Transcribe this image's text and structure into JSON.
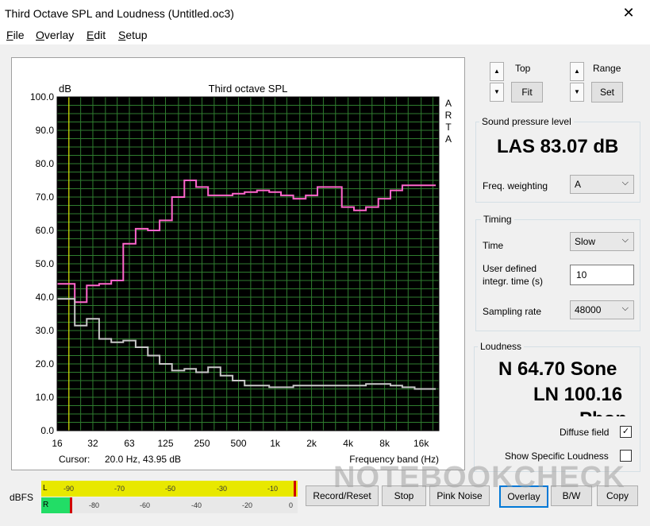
{
  "window": {
    "title": "Third Octave SPL and Loudness (Untitled.oc3)",
    "close_glyph": "✕"
  },
  "menu": [
    {
      "key": "F",
      "rest": "ile"
    },
    {
      "key": "O",
      "rest": "verlay"
    },
    {
      "key": "E",
      "rest": "dit"
    },
    {
      "key": "S",
      "rest": "etup"
    }
  ],
  "controls": {
    "top_label": "Top",
    "fit_label": "Fit",
    "range_label": "Range",
    "set_label": "Set",
    "spl_group": "Sound pressure level",
    "las_value": "LAS 83.07 dB",
    "freq_weighting_label": "Freq. weighting",
    "freq_weighting_value": "A",
    "timing_group": "Timing",
    "time_label": "Time",
    "time_value": "Slow",
    "user_integr_label_1": "User defined",
    "user_integr_label_2": "integr. time (s)",
    "user_integr_value": "10",
    "sampling_rate_label": "Sampling rate",
    "sampling_rate_value": "48000",
    "loudness_group": "Loudness",
    "loudness_n": "N 64.70 Sone",
    "loudness_ln": "LN 100.16",
    "loudness_unit": "Phon",
    "diffuse_field_label": "Diffuse field",
    "diffuse_field_checked": true,
    "show_specific_label": "Show Specific Loudness",
    "show_specific_checked": false
  },
  "bottom": {
    "dbfs_label": "dBFS",
    "meter_top_channel": "L",
    "meter_bot_channel": "R",
    "meter_top_ticks": [
      "-90",
      "-70",
      "-50",
      "-30",
      "-10"
    ],
    "meter_bot_ticks": [
      "-80",
      "-60",
      "-40",
      "-20",
      "0"
    ],
    "buttons": [
      "Record/Reset",
      "Stop",
      "Pink Noise",
      "Overlay",
      "B/W",
      "Copy"
    ]
  },
  "watermark": "NOTEBOOKCHECK",
  "chart_data": {
    "type": "line",
    "title": "Third octave SPL",
    "ylabel": "dB",
    "xlabel": "Frequency band (Hz)",
    "side_label": "ARTA",
    "ylim": [
      0,
      100
    ],
    "y_ticks": [
      "100.0",
      "90.0",
      "80.0",
      "70.0",
      "60.0",
      "50.0",
      "40.0",
      "30.0",
      "20.0",
      "10.0",
      "0.0"
    ],
    "x_ticks": [
      "16",
      "32",
      "63",
      "125",
      "250",
      "500",
      "1k",
      "2k",
      "4k",
      "8k",
      "16k"
    ],
    "cursor_label": "Cursor:",
    "cursor_value": "20.0 Hz, 43.95 dB",
    "cursor_hz": 20,
    "bands": [
      "16",
      "20",
      "25",
      "31.5",
      "40",
      "50",
      "63",
      "80",
      "100",
      "125",
      "160",
      "200",
      "250",
      "315",
      "400",
      "500",
      "630",
      "800",
      "1k",
      "1.25k",
      "1.6k",
      "2k",
      "2.5k",
      "3.15k",
      "4k",
      "5k",
      "6.3k",
      "8k",
      "10k",
      "12.5k",
      "16k",
      "20k"
    ],
    "series": [
      {
        "color": "#ff66cc",
        "values": [
          44,
          44,
          38.5,
          43.5,
          44,
          45,
          56,
          60.5,
          60,
          63,
          70,
          75,
          73,
          70.5,
          70.5,
          71,
          71.5,
          72,
          71.5,
          70.5,
          69.5,
          70.5,
          73,
          73,
          67,
          66,
          67,
          69.5,
          72,
          73.5,
          73.5,
          73.5
        ]
      },
      {
        "color": "#c8c8c8",
        "values": [
          39.5,
          39.5,
          31.5,
          33.5,
          27.5,
          26.5,
          27,
          25,
          22.5,
          20,
          18,
          18.5,
          17.5,
          19,
          16.5,
          15,
          13.5,
          13.5,
          13,
          13,
          13.5,
          13.5,
          13.5,
          13.5,
          13.5,
          13.5,
          14,
          14,
          13.5,
          13,
          12.5,
          12.5
        ]
      }
    ],
    "plot_bg": "#000000",
    "grid_color": "#2f7d2f",
    "cursor_color": "#ffff00"
  }
}
